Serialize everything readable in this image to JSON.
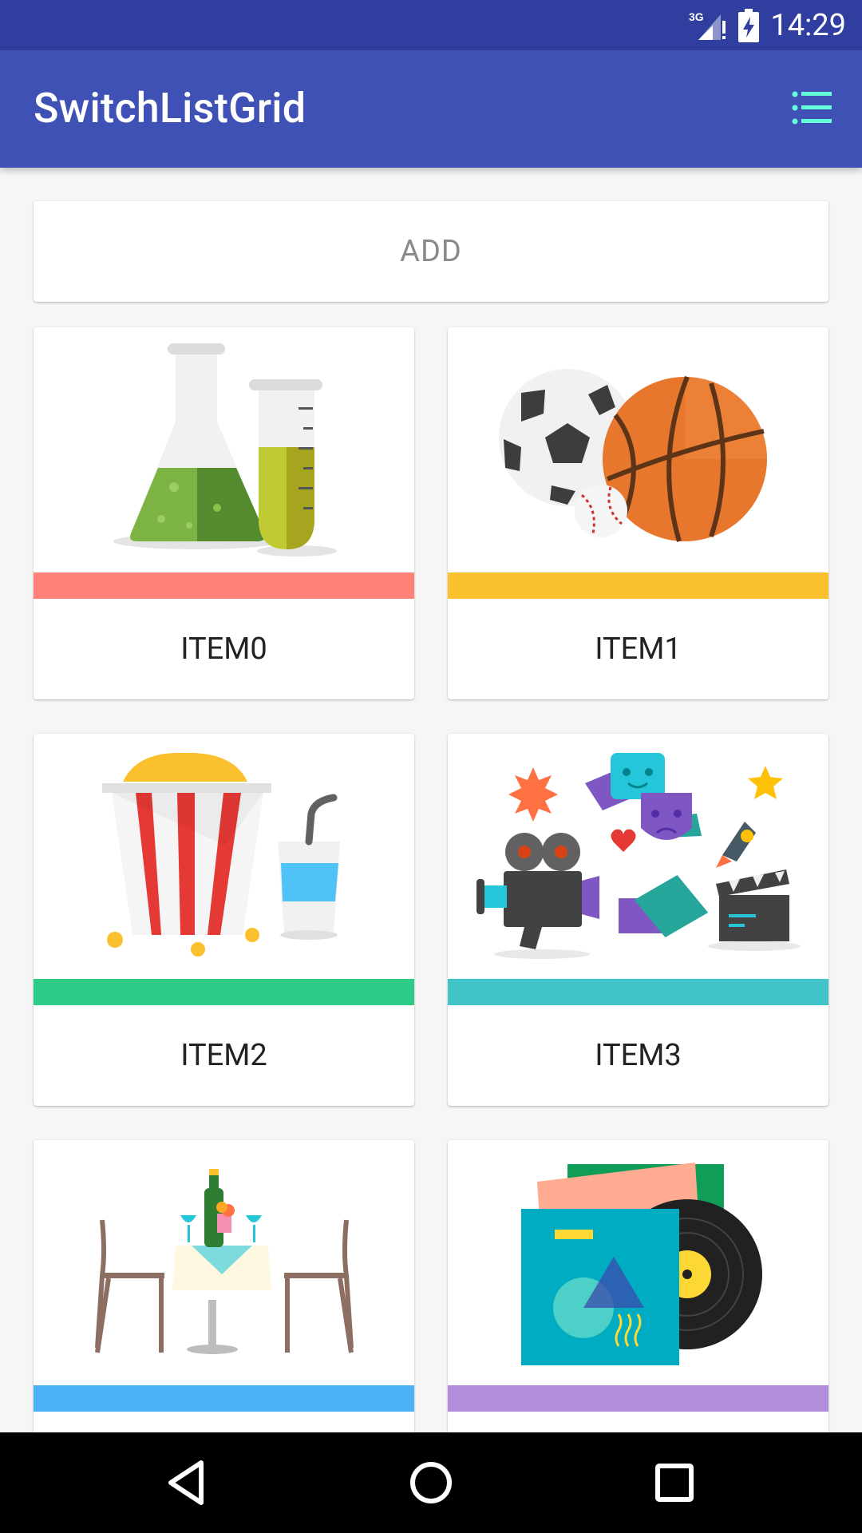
{
  "status_bar": {
    "network": "3G",
    "time": "14:29",
    "icons": [
      "signal-icon",
      "battery-charging-icon"
    ]
  },
  "app_bar": {
    "title": "SwitchListGrid",
    "action_icon": "list-view-icon"
  },
  "add_button": {
    "label": "ADD"
  },
  "items": [
    {
      "label": "ITEM0",
      "stripe_color": "#ff8177",
      "image": "science-lab-illustration"
    },
    {
      "label": "ITEM1",
      "stripe_color": "#fbc02d",
      "image": "sports-balls-illustration"
    },
    {
      "label": "ITEM2",
      "stripe_color": "#2ecc87",
      "image": "popcorn-drink-illustration"
    },
    {
      "label": "ITEM3",
      "stripe_color": "#40c4c8",
      "image": "entertainment-illustration"
    },
    {
      "label": "",
      "stripe_color": "#4db1f5",
      "image": "dining-table-illustration"
    },
    {
      "label": "",
      "stripe_color": "#b18ddb",
      "image": "music-album-illustration"
    }
  ],
  "navigation": {
    "buttons": [
      "back-icon",
      "home-icon",
      "recents-icon"
    ]
  },
  "colors": {
    "status_bar": "#303f9f",
    "app_bar": "#3f51b5",
    "menu_icon": "#64ffda",
    "background": "#f6f6f6"
  }
}
